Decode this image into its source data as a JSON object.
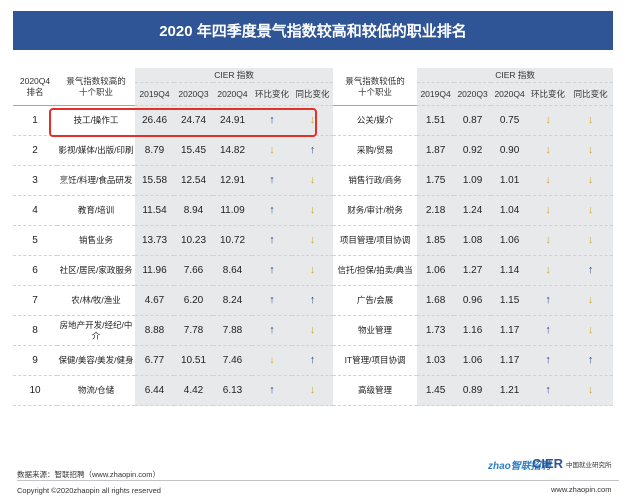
{
  "title": "2020 年四季度景气指数较高和较低的职业排名",
  "header": {
    "rank": "2020Q4\n排名",
    "high_job": "景气指数较高的\n十个职业",
    "low_job": "景气指数较低的\n十个职业",
    "cier": "CIER 指数",
    "cols": [
      "2019Q4",
      "2020Q3",
      "2020Q4",
      "环比变化",
      "同比变化"
    ]
  },
  "rows": [
    {
      "rank": "1",
      "high_job": "技工/操作工",
      "h19": "26.46",
      "h20q3": "24.74",
      "h20q4": "24.91",
      "h_mom": "up",
      "h_yoy": "down",
      "low_job": "公关/媒介",
      "l19": "1.51",
      "l20q3": "0.87",
      "l20q4": "0.75",
      "l_mom": "down",
      "l_yoy": "down"
    },
    {
      "rank": "2",
      "high_job": "影视/媒体/出版/印刷",
      "h19": "8.79",
      "h20q3": "15.45",
      "h20q4": "14.82",
      "h_mom": "down",
      "h_yoy": "up",
      "low_job": "采购/贸易",
      "l19": "1.87",
      "l20q3": "0.92",
      "l20q4": "0.90",
      "l_mom": "down",
      "l_yoy": "down"
    },
    {
      "rank": "3",
      "high_job": "烹饪/料理/食品研发",
      "h19": "15.58",
      "h20q3": "12.54",
      "h20q4": "12.91",
      "h_mom": "up",
      "h_yoy": "down",
      "low_job": "销售行政/商务",
      "l19": "1.75",
      "l20q3": "1.09",
      "l20q4": "1.01",
      "l_mom": "down",
      "l_yoy": "down"
    },
    {
      "rank": "4",
      "high_job": "教育/培训",
      "h19": "11.54",
      "h20q3": "8.94",
      "h20q4": "11.09",
      "h_mom": "up",
      "h_yoy": "down",
      "low_job": "财务/审计/税务",
      "l19": "2.18",
      "l20q3": "1.24",
      "l20q4": "1.04",
      "l_mom": "down",
      "l_yoy": "down"
    },
    {
      "rank": "5",
      "high_job": "销售业务",
      "h19": "13.73",
      "h20q3": "10.23",
      "h20q4": "10.72",
      "h_mom": "up",
      "h_yoy": "down",
      "low_job": "项目管理/项目协调",
      "l19": "1.85",
      "l20q3": "1.08",
      "l20q4": "1.06",
      "l_mom": "down",
      "l_yoy": "down"
    },
    {
      "rank": "6",
      "high_job": "社区/居民/家政服务",
      "h19": "11.96",
      "h20q3": "7.66",
      "h20q4": "8.64",
      "h_mom": "up",
      "h_yoy": "down",
      "low_job": "信托/担保/拍卖/典当",
      "l19": "1.06",
      "l20q3": "1.27",
      "l20q4": "1.14",
      "l_mom": "down",
      "l_yoy": "up"
    },
    {
      "rank": "7",
      "high_job": "农/林/牧/渔业",
      "h19": "4.67",
      "h20q3": "6.20",
      "h20q4": "8.24",
      "h_mom": "up",
      "h_yoy": "up",
      "low_job": "广告/会展",
      "l19": "1.68",
      "l20q3": "0.96",
      "l20q4": "1.15",
      "l_mom": "up",
      "l_yoy": "down"
    },
    {
      "rank": "8",
      "high_job": "房地产开发/经纪/中介",
      "h19": "8.88",
      "h20q3": "7.78",
      "h20q4": "7.88",
      "h_mom": "up",
      "h_yoy": "down",
      "low_job": "物业管理",
      "l19": "1.73",
      "l20q3": "1.16",
      "l20q4": "1.17",
      "l_mom": "up",
      "l_yoy": "down"
    },
    {
      "rank": "9",
      "high_job": "保健/美容/美发/健身",
      "h19": "6.77",
      "h20q3": "10.51",
      "h20q4": "7.46",
      "h_mom": "down",
      "h_yoy": "up",
      "low_job": "IT管理/项目协调",
      "l19": "1.03",
      "l20q3": "1.06",
      "l20q4": "1.17",
      "l_mom": "up",
      "l_yoy": "up"
    },
    {
      "rank": "10",
      "high_job": "物流/仓储",
      "h19": "6.44",
      "h20q3": "4.42",
      "h20q4": "6.13",
      "h_mom": "up",
      "h_yoy": "down",
      "low_job": "高级管理",
      "l19": "1.45",
      "l20q3": "0.89",
      "l20q4": "1.21",
      "l_mom": "up",
      "l_yoy": "down"
    }
  ],
  "arrows": {
    "up": "🡅",
    "down": "🡇"
  },
  "colors": {
    "title_bg": "#2f5596",
    "up": "#2e4e8a",
    "down": "#d1a82f",
    "highlight": "#e2302b",
    "grey": "#e8e9eb"
  },
  "footer": {
    "source": "数据来源：智联招聘（www.zhaopin.com）",
    "copyright": "Copyright ©2020zhaopin all rights reserved",
    "logo_zhaopin": "zhao智联招聘",
    "logo_cier": "CIER",
    "logo_cier_sub": "中国就业研究所",
    "url": "www.zhaopin.com"
  }
}
